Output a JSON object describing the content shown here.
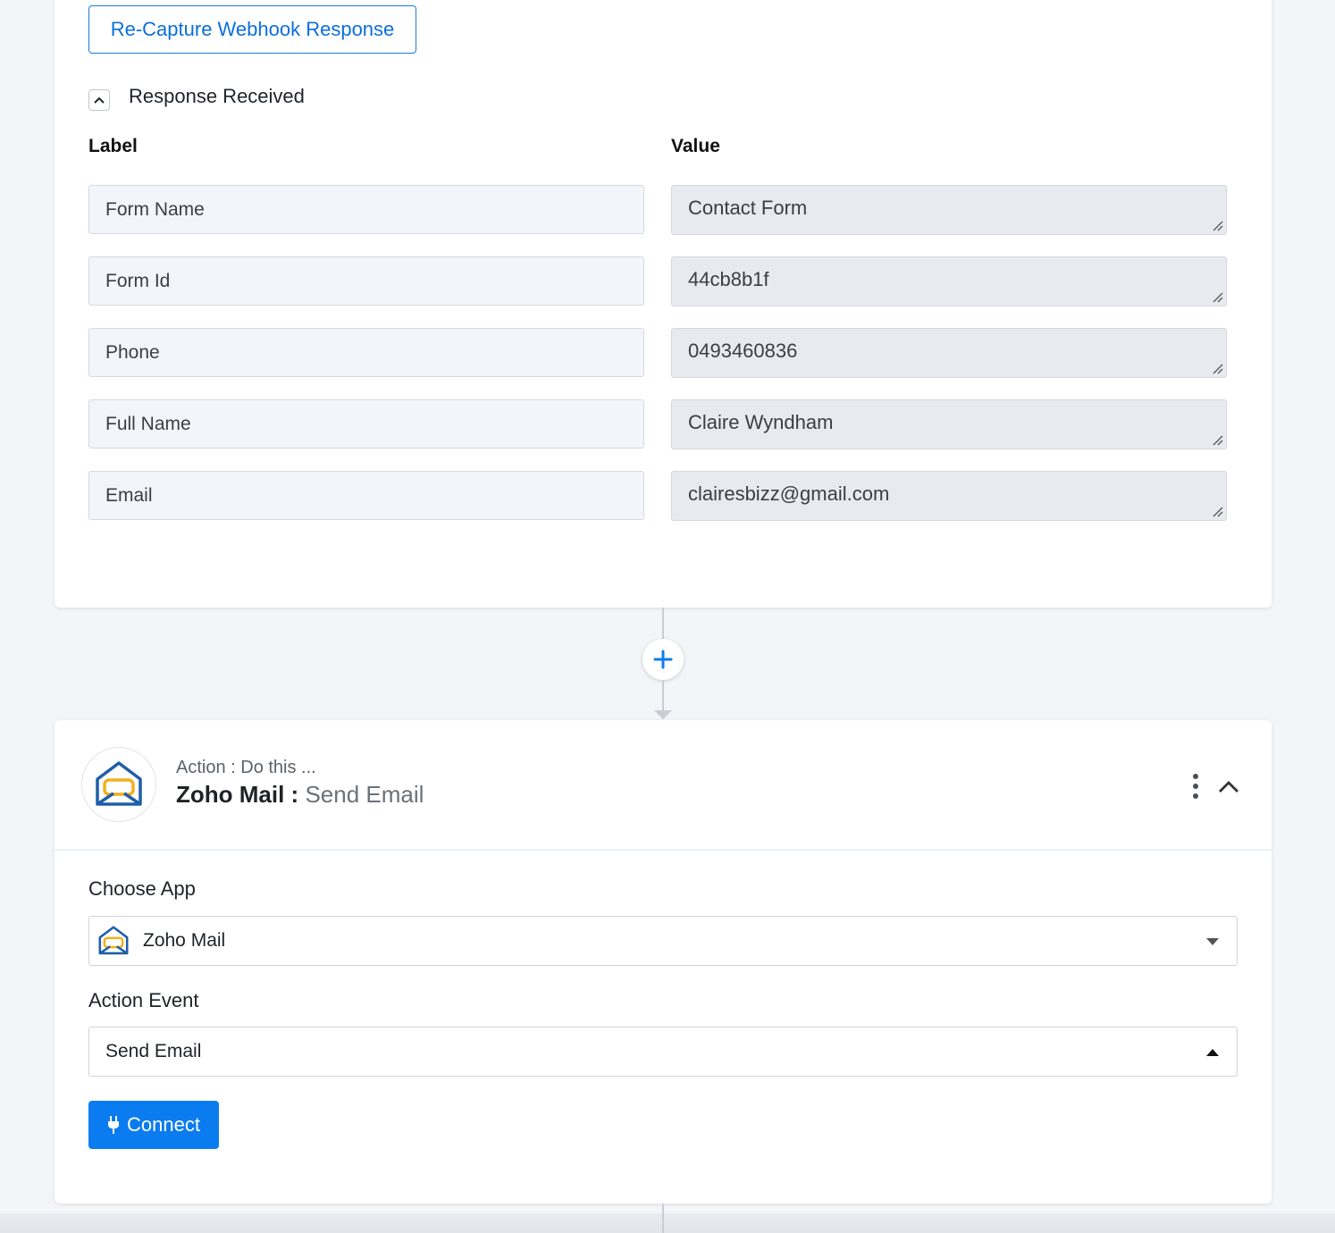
{
  "webhook": {
    "recapture_label": "Re-Capture Webhook Response",
    "response_title": "Response Received",
    "label_header": "Label",
    "value_header": "Value",
    "fields": [
      {
        "label": "Form Name",
        "value": "Contact Form"
      },
      {
        "label": "Form Id",
        "value": "44cb8b1f"
      },
      {
        "label": "Phone",
        "value": "0493460836"
      },
      {
        "label": "Full Name",
        "value": "Claire Wyndham"
      },
      {
        "label": "Email",
        "value": "clairesbizz@gmail.com"
      }
    ]
  },
  "action": {
    "subtitle": "Action : Do this ...",
    "app_name": "Zoho Mail :",
    "event_name": "Send Email",
    "choose_app_label": "Choose App",
    "selected_app": "Zoho Mail",
    "action_event_label": "Action Event",
    "selected_event": "Send Email",
    "connect_label": "Connect"
  },
  "icons": {
    "collapse_response": "chevron-up-icon",
    "add_step": "plus-icon",
    "app_logo": "zoho-mail-icon",
    "menu": "kebab-menu-icon",
    "collapse_card": "chevron-up-icon",
    "connect": "plug-icon"
  },
  "colors": {
    "accent": "#0b7cf0",
    "background": "#f3f5f8",
    "card": "#ffffff"
  }
}
